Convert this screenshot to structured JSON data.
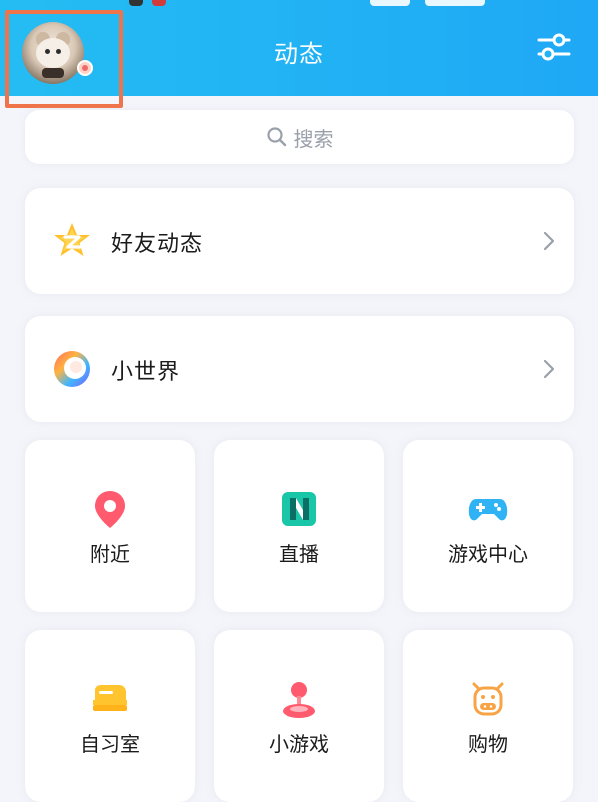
{
  "header": {
    "title": "动态"
  },
  "search": {
    "placeholder": "搜索"
  },
  "cards": [
    {
      "label": "好友动态",
      "icon": "qzone-star-icon"
    },
    {
      "label": "小世界",
      "icon": "small-world-ring-icon"
    }
  ],
  "tiles": [
    {
      "label": "附近",
      "icon": "location-pin-icon"
    },
    {
      "label": "直播",
      "icon": "live-n-icon"
    },
    {
      "label": "游戏中心",
      "icon": "gamepad-icon"
    },
    {
      "label": "自习室",
      "icon": "study-room-icon"
    },
    {
      "label": "小游戏",
      "icon": "joystick-icon"
    },
    {
      "label": "购物",
      "icon": "shopping-cow-icon"
    }
  ],
  "colors": {
    "header_start": "#24bdf3",
    "header_end": "#1fa8f5",
    "highlight_border": "#f0744a",
    "background": "#f3f5fa"
  }
}
